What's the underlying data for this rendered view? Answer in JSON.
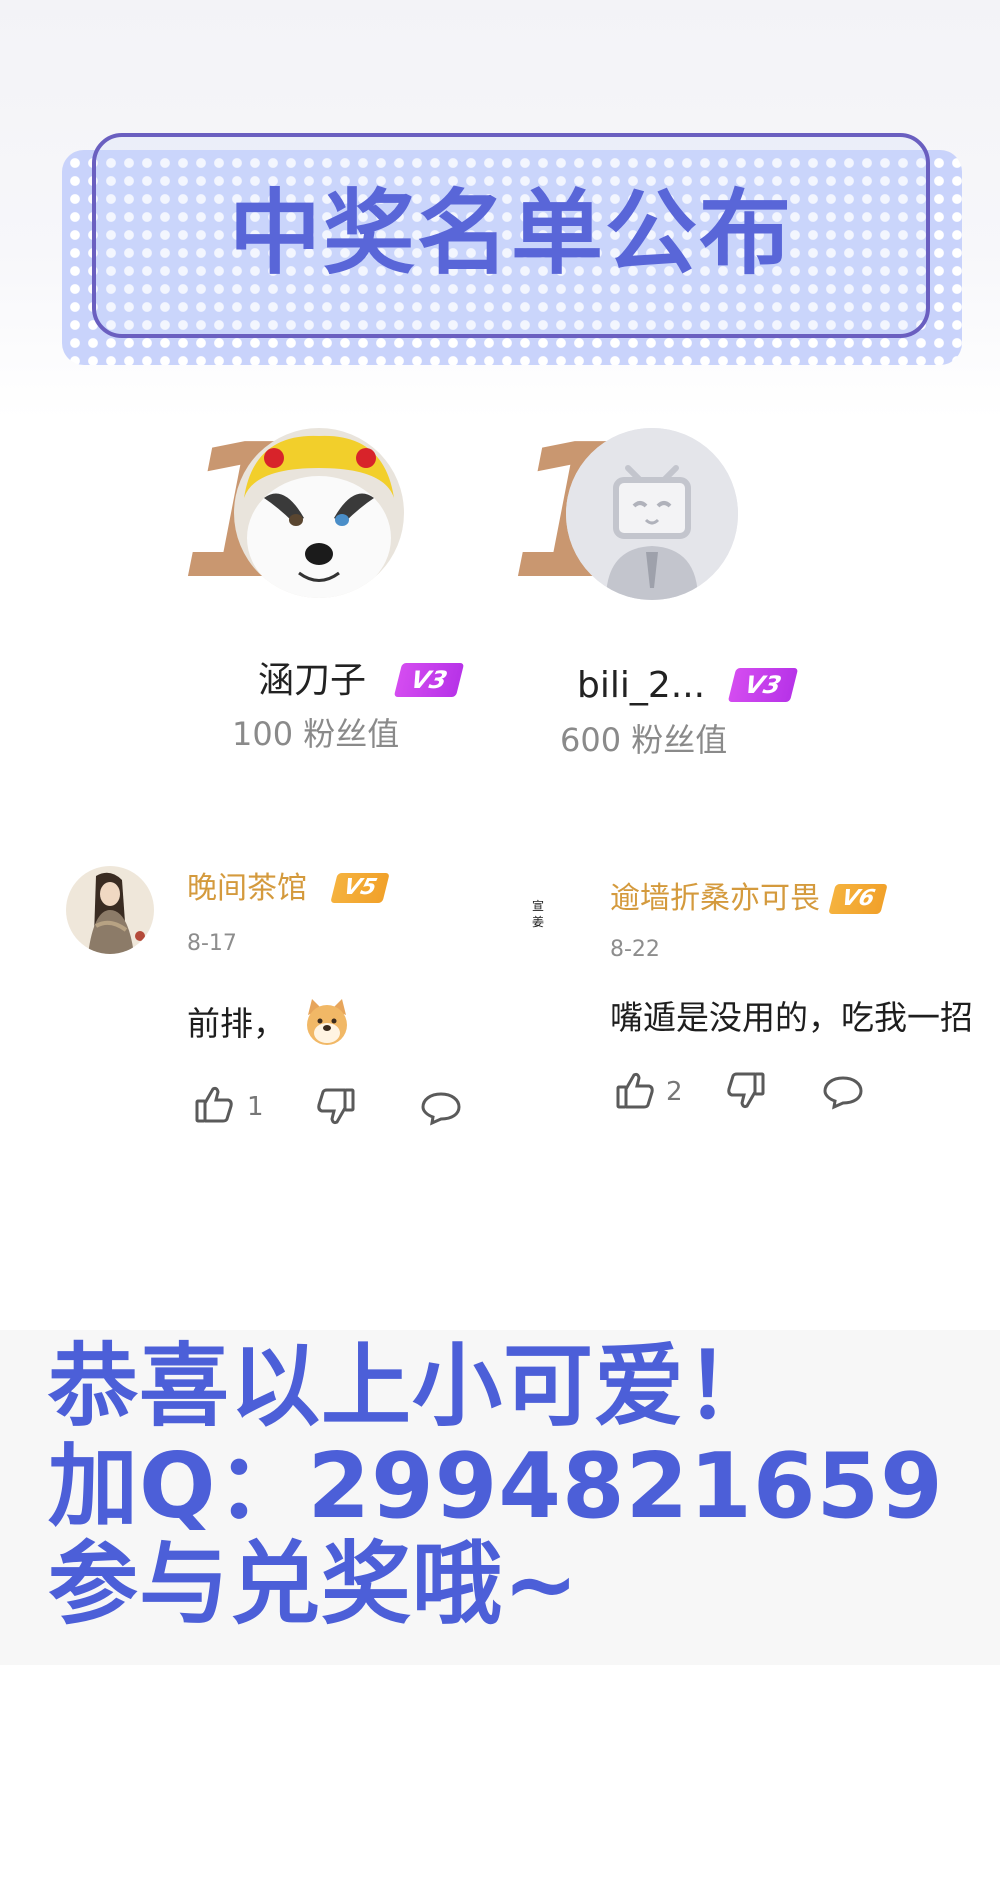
{
  "banner": {
    "title": "中奖名单公布"
  },
  "winners": [
    {
      "rank": "1",
      "name": "涵刀子",
      "level": "V3",
      "fans": "100 粉丝值"
    },
    {
      "rank": "1",
      "name": "bili_2...",
      "level": "V3",
      "fans": "600 粉丝值"
    }
  ],
  "comments": [
    {
      "name": "晚间茶馆",
      "level": "V5",
      "date": "8-17",
      "text": "前排，",
      "likes": "1"
    },
    {
      "name": "逾墙折桑亦可畏",
      "level": "V6",
      "date": "8-22",
      "text": "嘴遁是没用的，吃我一招",
      "likes": "2"
    }
  ],
  "side_mark": [
    "宣",
    "姜"
  ],
  "footer": {
    "line1": "恭喜以上小可爱！",
    "line2": "加Q：2994821659",
    "line3": "参与兑奖哦~"
  },
  "colors": {
    "title": "#5966d8",
    "footer_text": "#4c5fd8",
    "rank": "#c99770",
    "commenter": "#d49a3d"
  }
}
